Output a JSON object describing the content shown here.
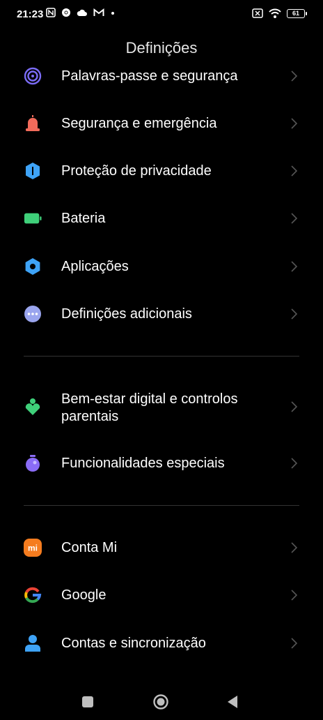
{
  "status_bar": {
    "time": "21:23",
    "battery_level": "61",
    "icons_left": [
      "nfc-icon",
      "chrome-icon",
      "cloud-icon",
      "gmail-icon",
      "dot-icon"
    ],
    "icons_right": [
      "sim-off-icon",
      "wifi-icon",
      "battery-icon"
    ]
  },
  "header": {
    "title": "Definições"
  },
  "menu": {
    "group1": [
      {
        "label": "Palavras-passe e segurança",
        "icon": "fingerprint-icon",
        "color": "#7b6cf6"
      },
      {
        "label": "Segurança e emergência",
        "icon": "alarm-icon",
        "color": "#f26b5b"
      },
      {
        "label": "Proteção de privacidade",
        "icon": "privacy-shield-icon",
        "color": "#3ea3f7"
      },
      {
        "label": "Bateria",
        "icon": "battery-icon",
        "color": "#3fd07a"
      },
      {
        "label": "Aplicações",
        "icon": "gear-icon",
        "color": "#3ea3f7"
      },
      {
        "label": "Definições adicionais",
        "icon": "more-icon",
        "color": "#9aa5ee"
      }
    ],
    "group2": [
      {
        "label_line1": "Bem-estar digital e controlos",
        "label_line2": "parentais",
        "icon": "wellbeing-icon",
        "color": "#3fd07a"
      },
      {
        "label": "Funcionalidades especiais",
        "icon": "special-features-icon",
        "color": "#8a6cf6"
      }
    ],
    "group3": [
      {
        "label": "Conta Mi",
        "icon": "mi-icon",
        "color": "#f57c1f"
      },
      {
        "label": "Google",
        "icon": "google-icon",
        "color": "#4285f4"
      },
      {
        "label": "Contas e sincronização",
        "icon": "account-icon",
        "color": "#3ea3f7"
      }
    ]
  },
  "nav_bar": {
    "icons": [
      "recent-apps-icon",
      "home-icon",
      "back-icon"
    ]
  }
}
